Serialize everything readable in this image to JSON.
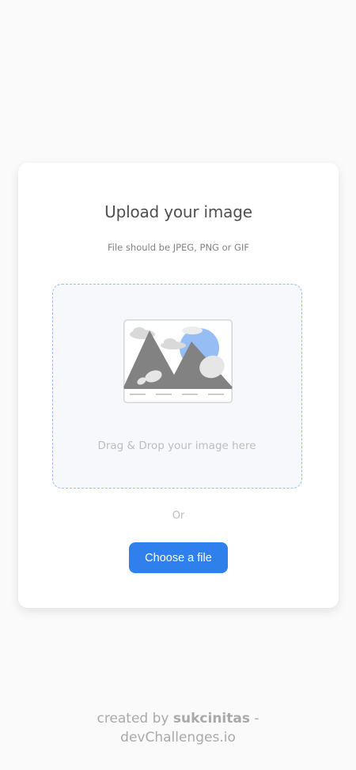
{
  "card": {
    "title": "Upload your image",
    "subtitle": "File should be JPEG, PNG or GIF"
  },
  "dropzone": {
    "text": "Drag & Drop your image here",
    "icon": "image-placeholder-icon"
  },
  "separator": "Or",
  "choose_button": {
    "label": "Choose a file"
  },
  "footer": {
    "prefix": "created by ",
    "author": "sukcinitas",
    "dash": " -",
    "site": "devChallenges.io"
  },
  "colors": {
    "background": "#fafafb",
    "card": "#ffffff",
    "accent": "#2f80ed",
    "dropzone_border": "#97bef4",
    "dropzone_bg": "#f6f8fb"
  }
}
